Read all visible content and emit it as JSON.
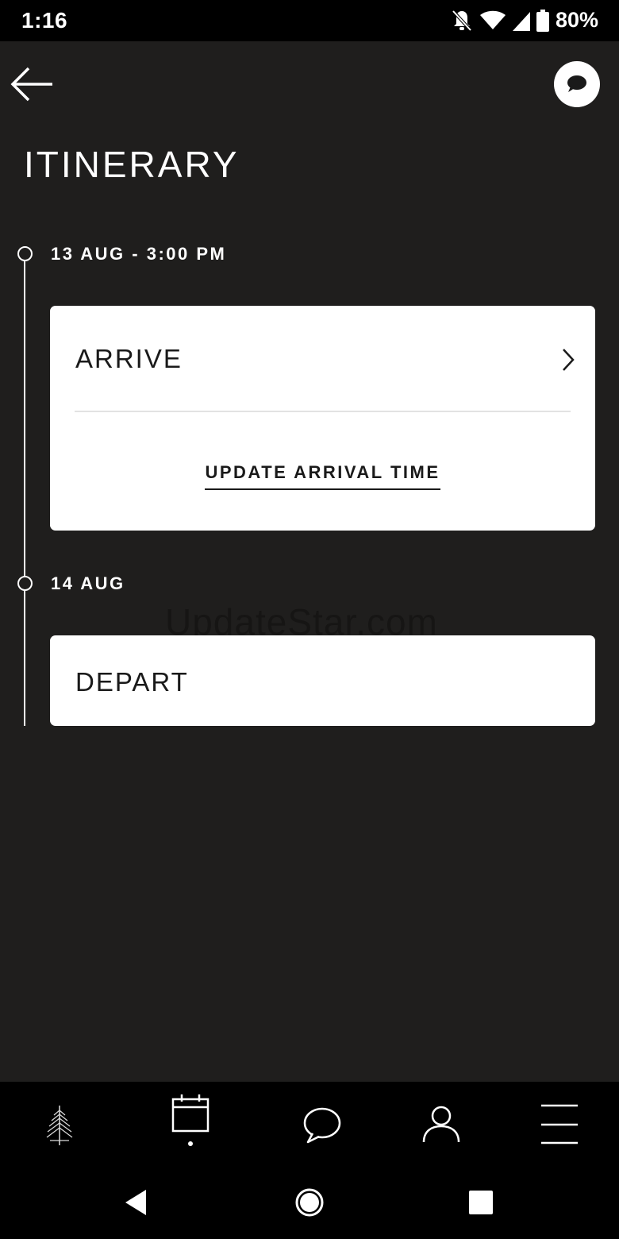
{
  "status": {
    "time": "1:16",
    "battery": "80%"
  },
  "header": {
    "title": "ITINERARY"
  },
  "itinerary": [
    {
      "date": "13 AUG - 3:00 PM",
      "card_title": "ARRIVE",
      "action": "UPDATE ARRIVAL TIME"
    },
    {
      "date": "14 AUG",
      "card_title": "DEPART"
    }
  ],
  "watermark": "UpdateStar.com",
  "bottom_nav": [
    "tree-logo-icon",
    "calendar-icon",
    "chat-bubble-icon",
    "person-icon",
    "menu-icon"
  ],
  "colors": {
    "background": "#1f1e1d",
    "card": "#ffffff",
    "bar": "#000000"
  }
}
